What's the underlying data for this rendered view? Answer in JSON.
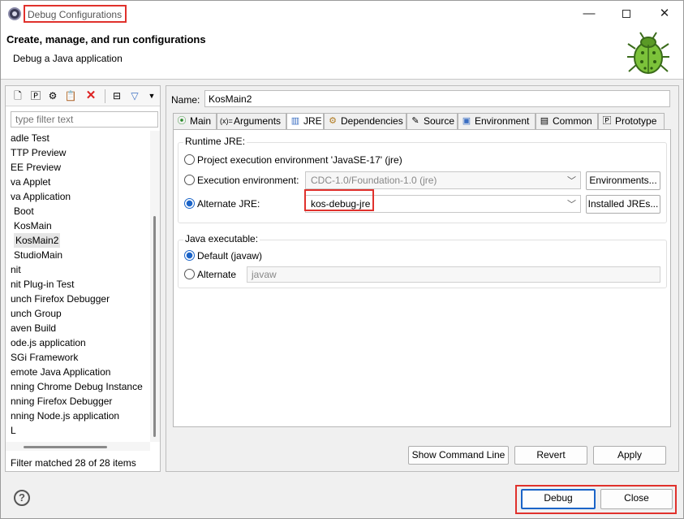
{
  "window": {
    "title": "Debug Configurations",
    "minimize": "—",
    "close": "✕"
  },
  "header": {
    "title": "Create, manage, and run configurations",
    "subtitle": "Debug a Java application"
  },
  "left": {
    "filter_placeholder": "type filter text",
    "items": [
      "adle Test",
      "TTP Preview",
      "EE Preview",
      "va Applet",
      "va Application",
      "Boot",
      "KosMain",
      "KosMain2",
      "StudioMain",
      "nit",
      "nit Plug-in Test",
      "unch Firefox Debugger",
      "unch Group",
      "aven Build",
      "ode.js application",
      "SGi Framework",
      "emote Java Application",
      "nning Chrome Debug Instance",
      "nning Firefox Debugger",
      "nning Node.js application",
      "L"
    ],
    "status": "Filter matched 28 of 28 items"
  },
  "right": {
    "name_label": "Name:",
    "name_value": "KosMain2",
    "tabs": [
      "Main",
      "Arguments",
      "JRE",
      "Dependencies",
      "Source",
      "Environment",
      "Common",
      "Prototype"
    ],
    "runtime_jre": {
      "title": "Runtime JRE:",
      "option_project": "Project execution environment 'JavaSE-17' (jre)",
      "option_exec_env": "Execution environment:",
      "exec_env_value": "CDC-1.0/Foundation-1.0 (jre)",
      "environments_button": "Environments...",
      "option_alternate": "Alternate JRE:",
      "alternate_value": "kos-debug-jre",
      "installed_button": "Installed JREs..."
    },
    "java_exe": {
      "title": "Java executable:",
      "option_default": "Default (javaw)",
      "option_alternate": "Alternate",
      "alternate_value": "javaw"
    },
    "buttons": {
      "show_cmd": "Show Command Line",
      "revert": "Revert",
      "apply": "Apply"
    }
  },
  "footer": {
    "help": "?",
    "debug": "Debug",
    "close": "Close"
  },
  "colors": {
    "highlight": "#e0312c",
    "accent": "#1b64c8"
  }
}
